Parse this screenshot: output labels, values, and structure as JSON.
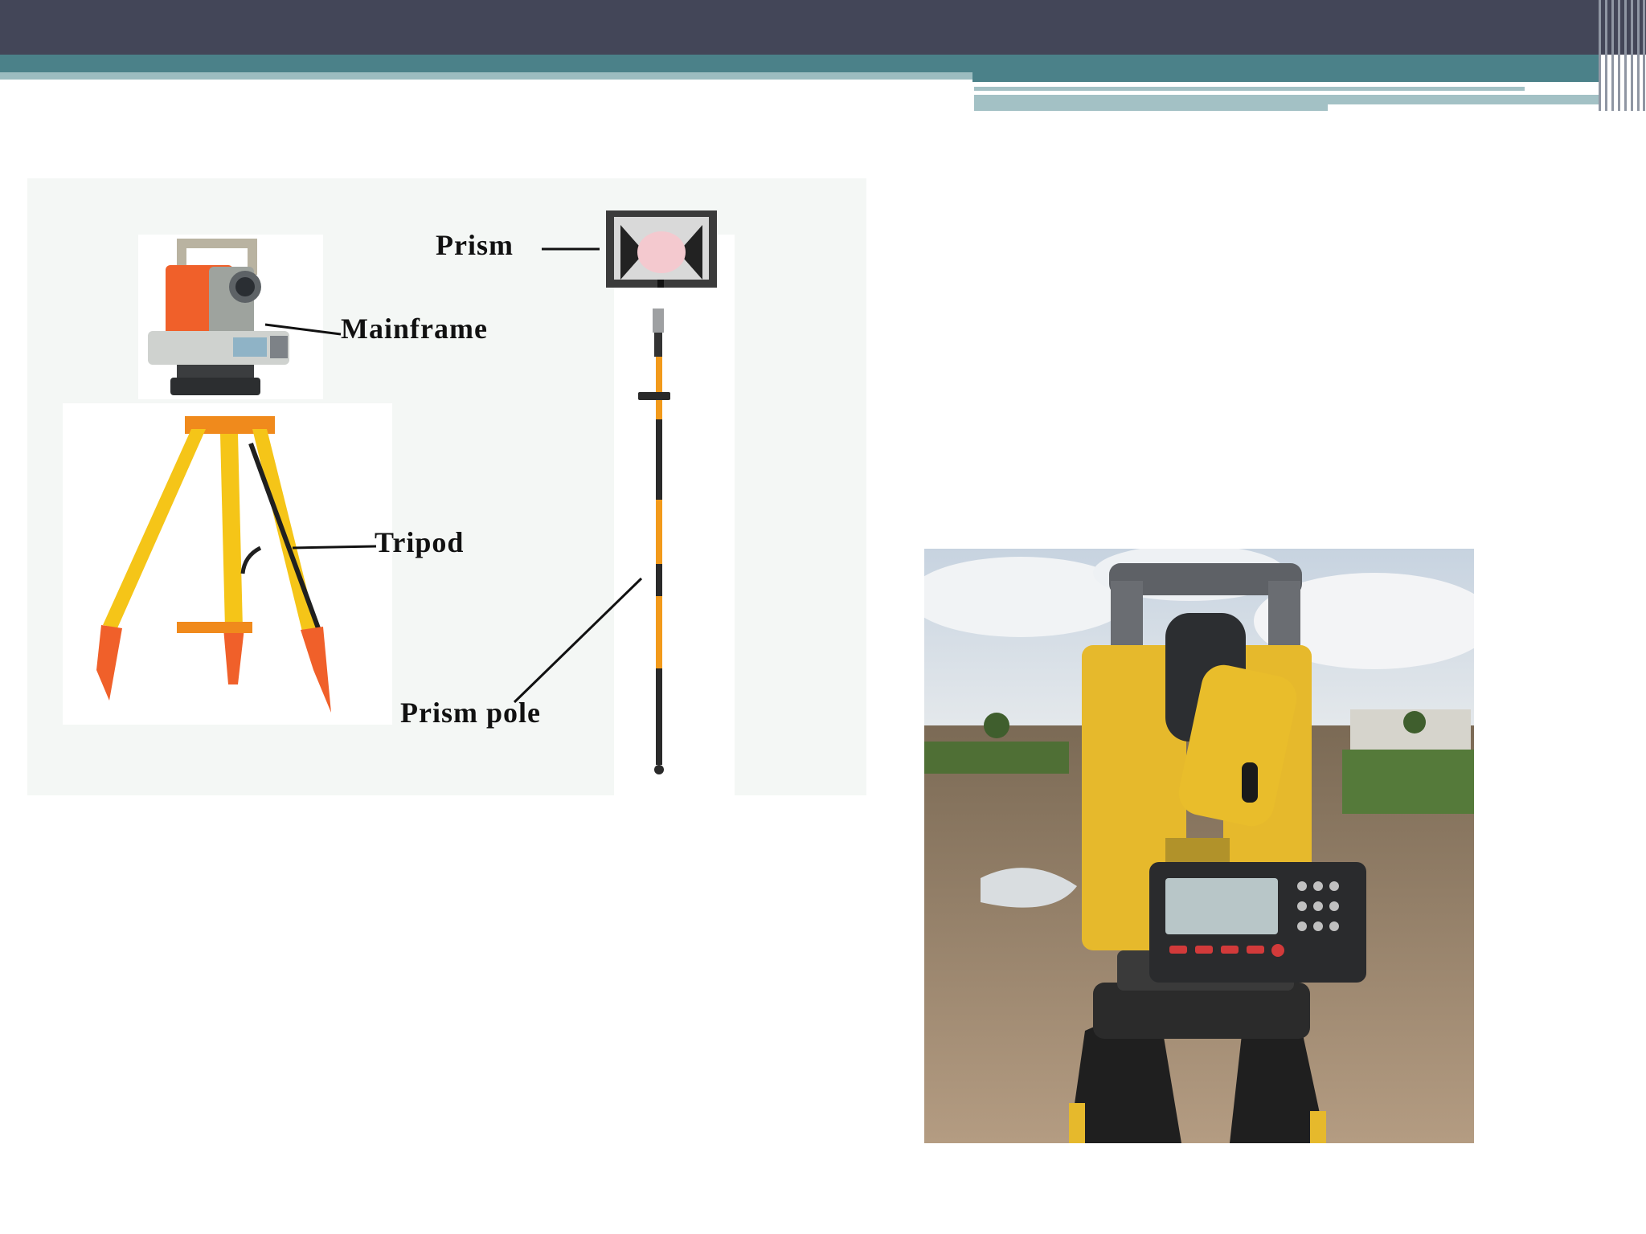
{
  "labels": {
    "prism": "Prism",
    "mainframe": "Mainframe",
    "tripod": "Tripod",
    "prism_pole": "Prism pole"
  },
  "colors": {
    "header_dark": "#434658",
    "header_teal": "#4b8189",
    "header_light": "#9cbcc0",
    "instrument_orange": "#f0602a",
    "tripod_yellow": "#f5c518",
    "pole_orange": "#f29a1b",
    "photo_instrument_yellow": "#e6b92c"
  },
  "icons": [
    "total-station-icon",
    "tripod-icon",
    "prism-icon",
    "prism-pole-icon"
  ]
}
